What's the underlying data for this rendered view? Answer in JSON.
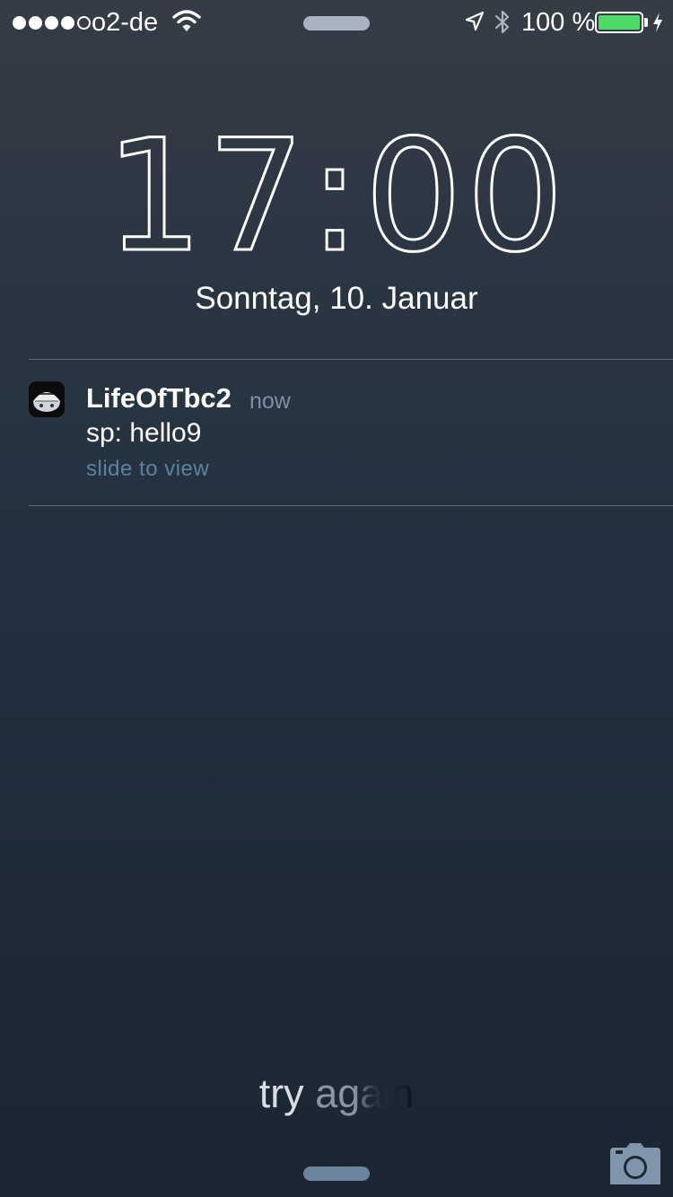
{
  "status_bar": {
    "signal_bars": 5,
    "signal_filled": 4,
    "carrier": "o2-de",
    "wifi_icon": "wifi-icon",
    "location_icon": "location-arrow-icon",
    "bluetooth_icon": "bluetooth-icon",
    "battery_percent": "100 %",
    "battery_level": 1.0,
    "battery_color": "#4cd964",
    "charging_icon": "lightning-bolt-icon"
  },
  "lockscreen": {
    "time": "17:00",
    "date": "Sonntag, 10. Januar"
  },
  "notification": {
    "app_icon": "app-icon",
    "app_name": "LifeOfTbc2",
    "time": "now",
    "message": "sp: hello9",
    "hint": "slide to view"
  },
  "bottom": {
    "unlock_prompt_word1": "try",
    "unlock_prompt_word2": "again",
    "camera_icon": "camera-icon"
  }
}
